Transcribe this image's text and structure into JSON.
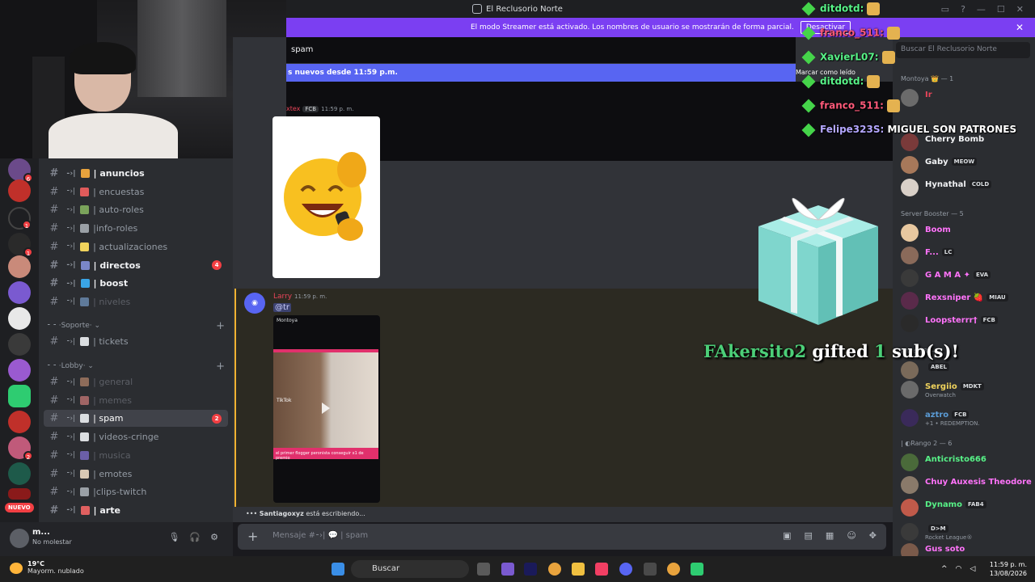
{
  "window": {
    "title": "El Reclusorio Norte"
  },
  "banner": {
    "text": "El modo Streamer está activado. Los nombres de usuario se mostrarán de forma parcial.",
    "button": "Desactivar"
  },
  "topbar": {
    "channel": "spam"
  },
  "newbar": {
    "text": "s nuevos desde 11:59 p.m.",
    "mark_read": "Marcar como leído"
  },
  "rail": {
    "new_label": "NUEVO",
    "badges": [
      "6",
      "1",
      "1",
      "2"
    ]
  },
  "channels": [
    {
      "icon_color": "#e8a33d",
      "name": "| anuncios",
      "state": "unread",
      "count": ""
    },
    {
      "icon_color": "#e05b5b",
      "name": "| encuestas",
      "state": "normal",
      "count": ""
    },
    {
      "icon_color": "#7aa35b",
      "name": "| auto-roles",
      "state": "normal",
      "count": ""
    },
    {
      "icon_color": "#9aa0a6",
      "name": "|info-roles",
      "state": "normal",
      "count": ""
    },
    {
      "icon_color": "#f0d35c",
      "name": "| actualizaciones",
      "state": "normal",
      "count": ""
    },
    {
      "icon_color": "#7a87c9",
      "name": "| directos",
      "state": "unread",
      "count": "4"
    },
    {
      "icon_color": "#3aa5e6",
      "name": "| boost",
      "state": "unread",
      "count": ""
    },
    {
      "icon_color": "#5f7a9a",
      "name": "| niveles",
      "state": "muted",
      "count": ""
    }
  ],
  "cat_soporte": {
    "label": "⁃ ⁃ ·Soporte· ⌄"
  },
  "ch_tickets": {
    "icon_color": "#dbdee1",
    "name": "| tickets",
    "state": "normal",
    "count": ""
  },
  "cat_lobby": {
    "label": "⁃ ⁃ ·Lobby· ⌄"
  },
  "channels2": [
    {
      "icon_color": "#8e6c5a",
      "name": "| general",
      "state": "muted",
      "count": ""
    },
    {
      "icon_color": "#a06565",
      "name": "| memes",
      "state": "muted",
      "count": ""
    },
    {
      "icon_color": "#dbdee1",
      "name": "| spam",
      "state": "active",
      "count": "2"
    },
    {
      "icon_color": "#dbdee1",
      "name": "| videos-cringe",
      "state": "normal",
      "count": ""
    },
    {
      "icon_color": "#6b5fa8",
      "name": "| musica",
      "state": "muted",
      "count": ""
    },
    {
      "icon_color": "#d9c9b5",
      "name": "| emotes",
      "state": "normal",
      "count": ""
    },
    {
      "icon_color": "#9aa0a6",
      "name": "|clips-twitch",
      "state": "normal",
      "count": ""
    },
    {
      "icon_color": "#e06060",
      "name": "| arte",
      "state": "unread",
      "count": ""
    }
  ],
  "user": {
    "name": "m...",
    "status": "No molestar"
  },
  "msg1": {
    "user": "xtex",
    "tag": "FCB",
    "time": "11:59 p. m."
  },
  "msg2": {
    "user": "Larry",
    "time": "11:59 p. m.",
    "mention": "@tr",
    "video_chip": "Montoya",
    "video_tiktok": "TikTok",
    "video_caption": "el primer flogger peronista conseguir x1 de premio"
  },
  "typing": {
    "who": "Santiagoxyz",
    "text": "está escribiendo..."
  },
  "composer": {
    "placeholder": "Mensaje #⁃›| 💬 | spam"
  },
  "members": {
    "search_placeholder": "Buscar El Reclusorio Norte",
    "groups": [
      {
        "label": "Montoya 👑 — 1"
      },
      {
        "label": "Server Booster — 5"
      },
      {
        "label": "Rango 3 — 3"
      },
      {
        "label": "| ◐Rango 2 — 6"
      }
    ],
    "list": [
      {
        "name": "Ir",
        "color": "#e9455a",
        "chip": "",
        "sub": "",
        "av": "#6b6b6b"
      },
      {
        "name": "Cherry Bomb",
        "color": "#f2f3f5",
        "chip": "",
        "sub": "",
        "av": "#7a3a3a"
      },
      {
        "name": "Gaby",
        "color": "#f2f3f5",
        "chip": "MEOW",
        "sub": "",
        "av": "#a7785a"
      },
      {
        "name": "Hynathal",
        "color": "#f2f3f5",
        "chip": "COLD",
        "sub": "",
        "av": "#d9d0c8"
      },
      {
        "name": "Boom",
        "color": "#ff73fa",
        "chip": "",
        "sub": "",
        "av": "#e8c8a0"
      },
      {
        "name": "F...",
        "color": "#ff73fa",
        "chip": "LC",
        "sub": "",
        "av": "#8a6a5a"
      },
      {
        "name": "G A M A ✦",
        "color": "#ff73fa",
        "chip": "EVA",
        "sub": "",
        "av": "#3a3a3a"
      },
      {
        "name": "Rexsniper 🍓",
        "color": "#ff73fa",
        "chip": "MIAU",
        "sub": "",
        "av": "#5a2a4a"
      },
      {
        "name": "Loopsterrr†",
        "color": "#ff73fa",
        "chip": "FCB",
        "sub": "",
        "av": "#2a2a2a"
      },
      {
        "name": "",
        "color": "#f2f3f5",
        "chip": "ABEL",
        "sub": "",
        "av": "#7a6a5a"
      },
      {
        "name": "Sergiio",
        "color": "#f0d35c",
        "chip": "MDKT",
        "sub": "Overwatch",
        "av": "#6a6a6a"
      },
      {
        "name": "aztro",
        "color": "#5b9bd5",
        "chip": "FCB",
        "sub": "+1 • REDEMPTION.",
        "av": "#3a2a5a"
      },
      {
        "name": "Anticristo666",
        "color": "#57f287",
        "chip": "",
        "sub": "",
        "av": "#4a6a3a"
      },
      {
        "name": "Chuy Auxesis Theodore D...",
        "color": "#ff73fa",
        "chip": "",
        "sub": "",
        "av": "#8a7a6a"
      },
      {
        "name": "Dynamo",
        "color": "#57f287",
        "chip": "FAB4",
        "sub": "",
        "av": "#c05a4a"
      },
      {
        "name": "",
        "color": "#f2f3f5",
        "chip": "D>M",
        "sub": "Rocket League®",
        "av": "#3a3a3a"
      },
      {
        "name": "Gus soto",
        "color": "#ff73fa",
        "chip": "",
        "sub": "",
        "av": "#7a5a4a"
      }
    ]
  },
  "twitch_chat": [
    {
      "user": "ditdotd:",
      "color": "#57f287",
      "text": ""
    },
    {
      "user": "franco_511:",
      "color": "#ff5a7a",
      "text": ""
    },
    {
      "user": "XavierL07:",
      "color": "#57f287",
      "text": ""
    },
    {
      "user": "ditdotd:",
      "color": "#57f287",
      "text": ""
    },
    {
      "user": "franco_511:",
      "color": "#ff5a7a",
      "text": ""
    },
    {
      "user": "Felipe323S:",
      "color": "#b4a7ff",
      "text": "MIGUEL SON PATRONES"
    }
  ],
  "gift": {
    "user": "FAkersito2",
    "mid": "gifted",
    "count": "1",
    "suffix": "sub(s)!"
  },
  "taskbar": {
    "temp": "19°C",
    "weather": "Mayorm. nublado",
    "search": "Buscar",
    "time": "11:59 p. m.",
    "date": "13/08/2026"
  },
  "colors": {
    "accent": "#5865f2",
    "banner": "#7b3ff2",
    "mention_bar": "#f0b232"
  }
}
